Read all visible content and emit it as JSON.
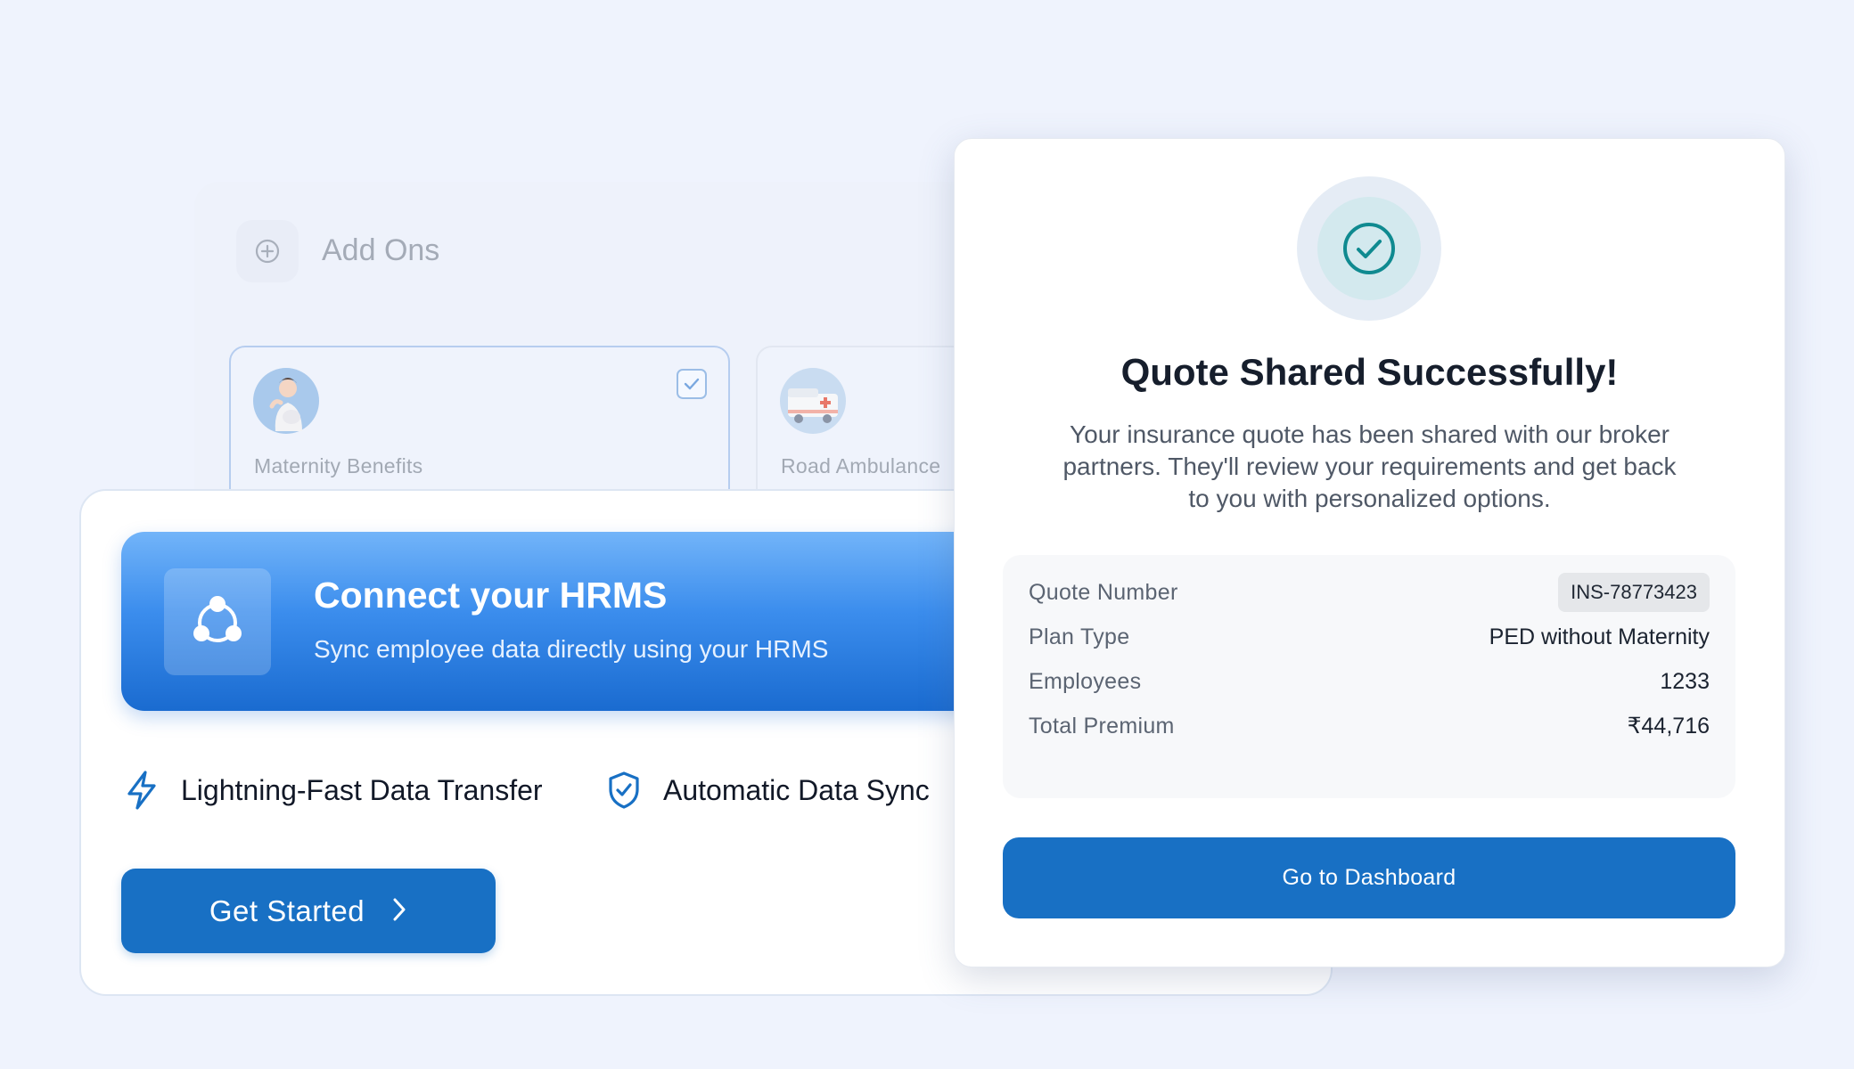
{
  "addons": {
    "title": "Add Ons",
    "tiles": [
      {
        "label": "Maternity Benefits",
        "selected": true
      },
      {
        "label": "Road  Ambulance",
        "selected": false
      }
    ]
  },
  "hrms": {
    "title": "Connect your HRMS",
    "subtitle": "Sync employee data directly using your HRMS",
    "features": [
      {
        "icon": "lightning-icon",
        "label": "Lightning-Fast Data Transfer"
      },
      {
        "icon": "shield-check-icon",
        "label": "Automatic Data Sync"
      }
    ],
    "cta_label": "Get Started"
  },
  "modal": {
    "title": "Quote Shared Successfully!",
    "description": "Your insurance quote has been shared with our broker partners. They'll review your requirements and get back to you with personalized options.",
    "details": {
      "quote_number": {
        "label": "Quote Number",
        "value": "INS-78773423"
      },
      "plan_type": {
        "label": "Plan Type",
        "value": "PED without Maternity"
      },
      "employees": {
        "label": "Employees",
        "value": "1233"
      },
      "total_premium": {
        "label": "Total Premium",
        "value": "₹44,716"
      }
    },
    "cta_label": "Go to Dashboard"
  },
  "colors": {
    "primary": "#1870c4",
    "background": "#eff3fd",
    "success": "#0f8a90"
  }
}
